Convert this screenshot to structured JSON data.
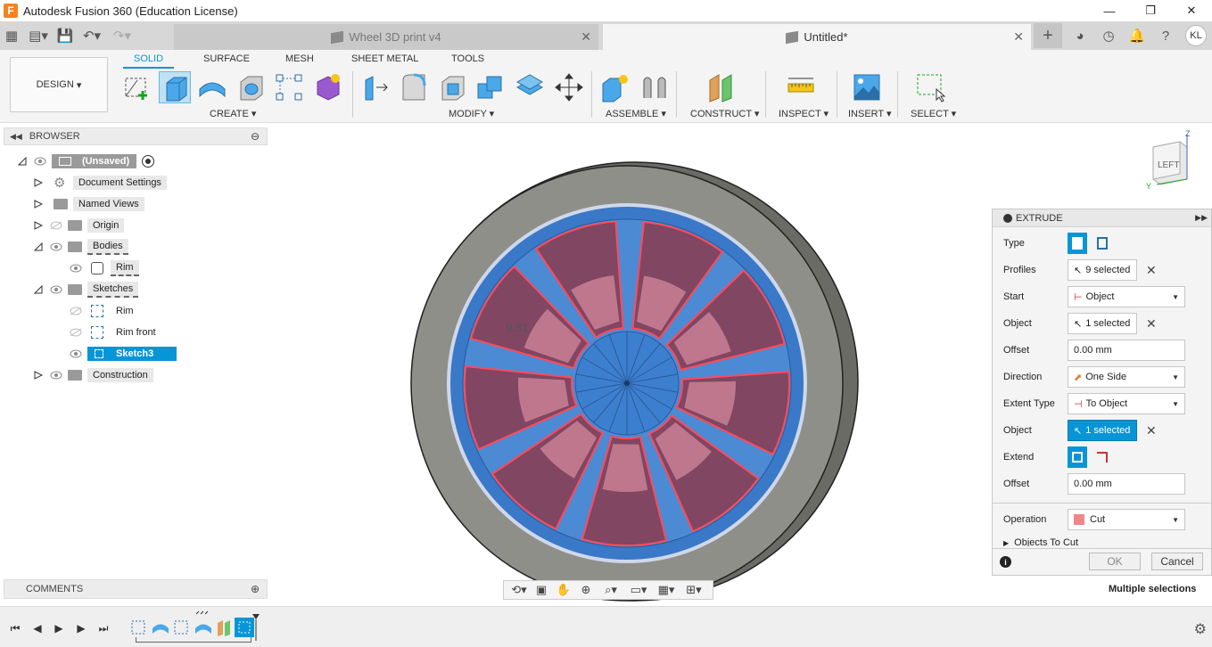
{
  "window": {
    "title": "Autodesk Fusion 360 (Education License)",
    "logo": "F"
  },
  "tabs": [
    {
      "label": "Wheel 3D print v4",
      "active": false
    },
    {
      "label": "Untitled*",
      "active": true
    }
  ],
  "user": {
    "initials": "KL"
  },
  "toolbar": {
    "design_label": "DESIGN",
    "workspace_tabs": [
      "SOLID",
      "SURFACE",
      "MESH",
      "SHEET METAL",
      "TOOLS"
    ],
    "groups": [
      "CREATE",
      "MODIFY",
      "ASSEMBLE",
      "CONSTRUCT",
      "INSPECT",
      "INSERT",
      "SELECT"
    ]
  },
  "browser": {
    "title": "BROWSER",
    "root": "(Unsaved)",
    "items": [
      {
        "label": "Document Settings"
      },
      {
        "label": "Named Views"
      },
      {
        "label": "Origin"
      },
      {
        "label": "Bodies"
      },
      {
        "label": "Rim"
      },
      {
        "label": "Sketches"
      },
      {
        "label": "Rim"
      },
      {
        "label": "Rim front"
      },
      {
        "label": "Sketch3"
      },
      {
        "label": "Construction"
      }
    ]
  },
  "comments": {
    "title": "COMMENTS"
  },
  "viewport": {
    "dimension": "9.81",
    "viewcube": "LEFT",
    "axis_z": "Z",
    "axis_y": "Y"
  },
  "extrude": {
    "title": "EXTRUDE",
    "rows": [
      {
        "label": "Type",
        "value": ""
      },
      {
        "label": "Profiles",
        "value": "9 selected"
      },
      {
        "label": "Start",
        "value": "Object"
      },
      {
        "label": "Object",
        "value": "1 selected"
      },
      {
        "label": "Offset",
        "value": "0.00 mm"
      },
      {
        "label": "Direction",
        "value": "One Side"
      },
      {
        "label": "Extent Type",
        "value": "To Object"
      },
      {
        "label": "Object",
        "value": "1 selected"
      },
      {
        "label": "Extend",
        "value": ""
      },
      {
        "label": "Offset",
        "value": "0.00 mm"
      },
      {
        "label": "Operation",
        "value": "Cut"
      }
    ],
    "objects_to_cut": "Objects To Cut",
    "ok": "OK",
    "cancel": "Cancel"
  },
  "status": {
    "text": "Multiple selections"
  },
  "colors": {
    "accent": "#0696d7",
    "profile_fill": "#8a3a4e",
    "wheel_blue": "#3a78c8",
    "tire_gray": "#8f8f8a"
  }
}
